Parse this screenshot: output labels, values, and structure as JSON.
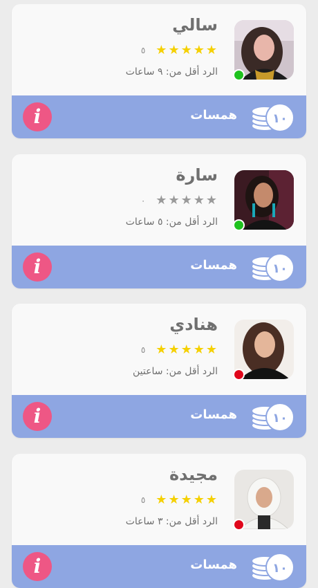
{
  "colors": {
    "card_background": "#f9f9f9",
    "bar_background": "#8ea6e2",
    "info_button": "#ee5785",
    "star_filled": "#f5d000",
    "star_empty": "#9a9a9a",
    "online": "#1ec21e",
    "offline": "#e0061b"
  },
  "advisors": [
    {
      "name": "سالي",
      "rating": 5,
      "rating_label": "٥",
      "reply_time": "الرد أقل من: ٩ ساعات",
      "status": "online",
      "status_color": "#1ec21e",
      "avatar_icon": "woman-portrait-dark-hair",
      "coins_value": "١٠",
      "coins_label": "همسات",
      "info_icon": "info-icon"
    },
    {
      "name": "سارة",
      "rating": 0,
      "rating_label": "٠",
      "reply_time": "الرد أقل من: ٥ ساعات",
      "status": "online",
      "status_color": "#1ec21e",
      "avatar_icon": "woman-portrait-blue-earrings",
      "coins_value": "١٠",
      "coins_label": "همسات",
      "info_icon": "info-icon"
    },
    {
      "name": "هنادي",
      "rating": 5,
      "rating_label": "٥",
      "reply_time": "الرد أقل من: ساعتين",
      "status": "offline",
      "status_color": "#e0061b",
      "avatar_icon": "woman-portrait-long-hair",
      "coins_value": "١٠",
      "coins_label": "همسات",
      "info_icon": "info-icon"
    },
    {
      "name": "مجيدة",
      "rating": 5,
      "rating_label": "٥",
      "reply_time": "الرد أقل من: ٣ ساعات",
      "status": "offline",
      "status_color": "#e0061b",
      "avatar_icon": "woman-portrait-white-hijab",
      "coins_value": "١٠",
      "coins_label": "همسات",
      "info_icon": "info-icon"
    }
  ]
}
